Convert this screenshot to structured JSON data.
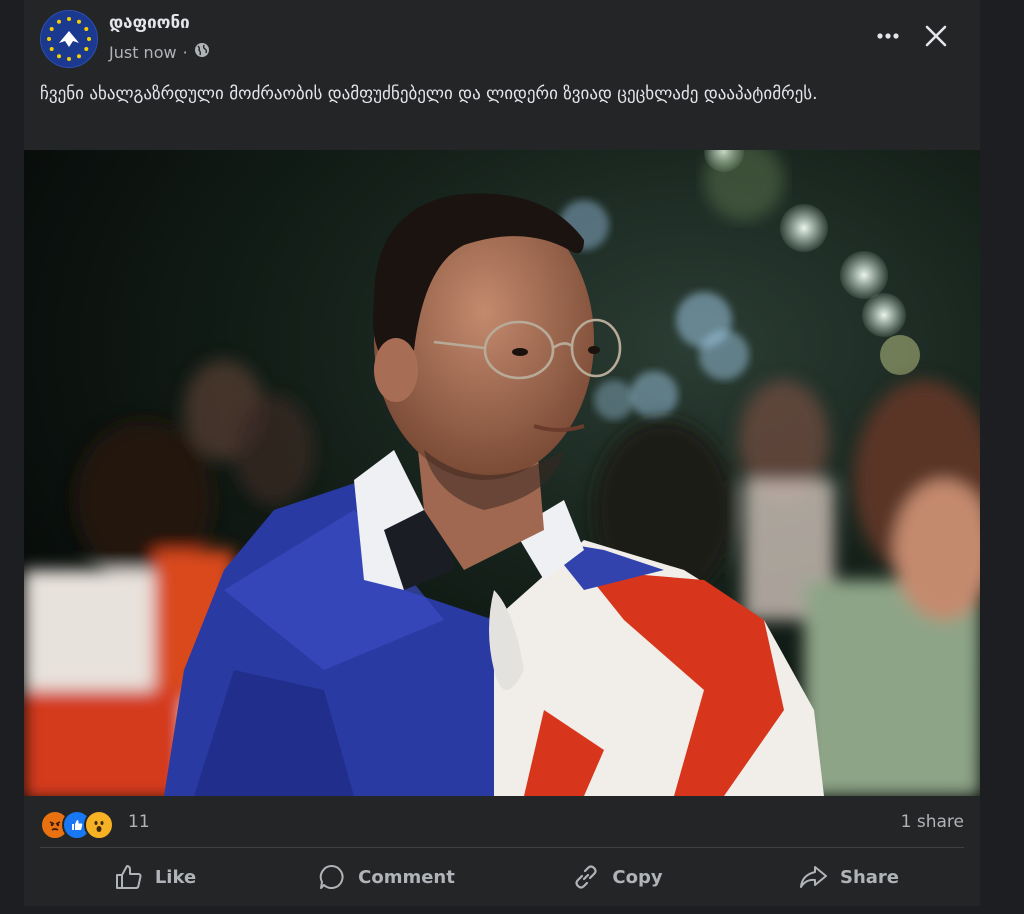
{
  "post": {
    "page_name": "დაფიონი",
    "timestamp": "Just now",
    "separator": "·",
    "privacy_icon": "globe-icon",
    "text": "ჩვენი ახალგაზრდული მოძრაობის დამფუძნებელი და ლიდერი ზვიად ცეცხლაძე დააპატიმრეს."
  },
  "header": {
    "more_icon": "more-dots-icon",
    "close_icon": "close-icon"
  },
  "stats": {
    "reactions": [
      "angry",
      "like",
      "wow"
    ],
    "reaction_count": "11",
    "share_count": "1 share"
  },
  "actions": {
    "like": "Like",
    "comment": "Comment",
    "copy": "Copy",
    "share": "Share"
  },
  "colors": {
    "background": "#1c1e21",
    "card": "#242526",
    "text_primary": "#e4e6eb",
    "text_secondary": "#b0b3b8",
    "like_blue": "#1877f2",
    "angry": "#e9710f",
    "wow": "#f7b125"
  }
}
